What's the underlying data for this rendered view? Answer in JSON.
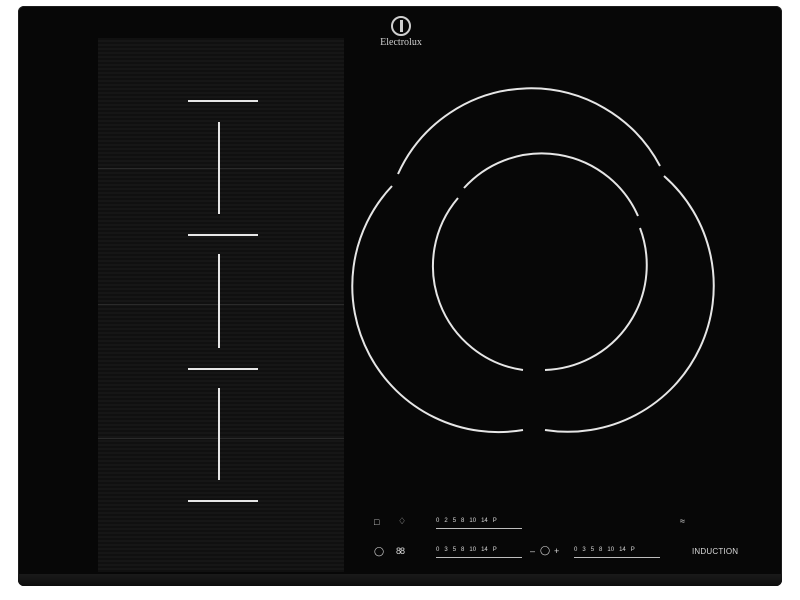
{
  "brand": "Electrolux",
  "induction_label": "INDUCTION",
  "scale_top_left": [
    "0",
    "2",
    "5",
    "8",
    "10",
    "14",
    "P"
  ],
  "scale_bottom_left": [
    "0",
    "3",
    "5",
    "8",
    "10",
    "14",
    "P"
  ],
  "scale_bottom_right": [
    "0",
    "3",
    "5",
    "8",
    "10",
    "14",
    "P"
  ],
  "timer_minus": "–",
  "timer_plus": "+",
  "icons": {
    "lock": "lock-icon",
    "chef": "chef-hat-icon",
    "power": "power-icon",
    "display": "display-icon",
    "timer": "timer-icon",
    "hob2hood": "wireless-icon"
  },
  "colors": {
    "glass": "#070707",
    "markings": "#e6e6e6"
  }
}
